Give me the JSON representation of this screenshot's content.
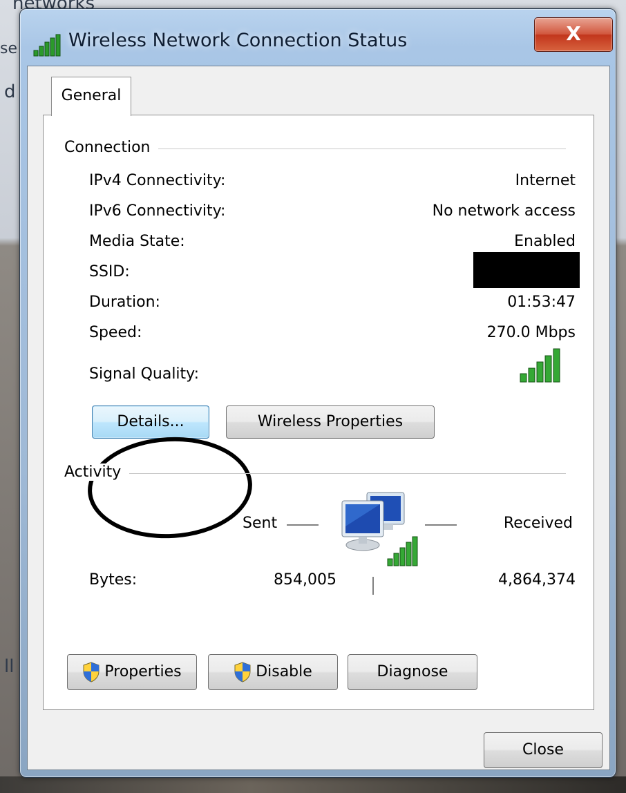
{
  "background": {
    "text_top": "networks",
    "text_left_1": "se",
    "text_left_2": "d",
    "text_left_3": "ll"
  },
  "window": {
    "title": "Wireless Network Connection Status",
    "close_glyph": "X",
    "title_icon": "signal-bars-icon"
  },
  "tabs": [
    {
      "label": "General"
    }
  ],
  "connection": {
    "heading": "Connection",
    "rows": [
      {
        "label": "IPv4 Connectivity:",
        "value": "Internet"
      },
      {
        "label": "IPv6 Connectivity:",
        "value": "No network access"
      },
      {
        "label": "Media State:",
        "value": "Enabled"
      },
      {
        "label": "SSID:",
        "value": ""
      },
      {
        "label": "Duration:",
        "value": "01:53:47"
      },
      {
        "label": "Speed:",
        "value": "270.0 Mbps"
      }
    ],
    "signal_label": "Signal Quality:",
    "signal_bars": 5,
    "signal_bars_total": 5
  },
  "buttons": {
    "details": "Details...",
    "wireless_properties": "Wireless Properties",
    "properties": "Properties",
    "disable": "Disable",
    "diagnose": "Diagnose",
    "close": "Close"
  },
  "activity": {
    "heading": "Activity",
    "sent_label": "Sent",
    "received_label": "Received",
    "bytes_label": "Bytes:",
    "bytes_sent": "854,005",
    "bytes_received": "4,864,374"
  },
  "colors": {
    "signal_green": "#2a8a2a",
    "close_red": "#c2361c",
    "focus_blue": "#3c7fb1"
  }
}
